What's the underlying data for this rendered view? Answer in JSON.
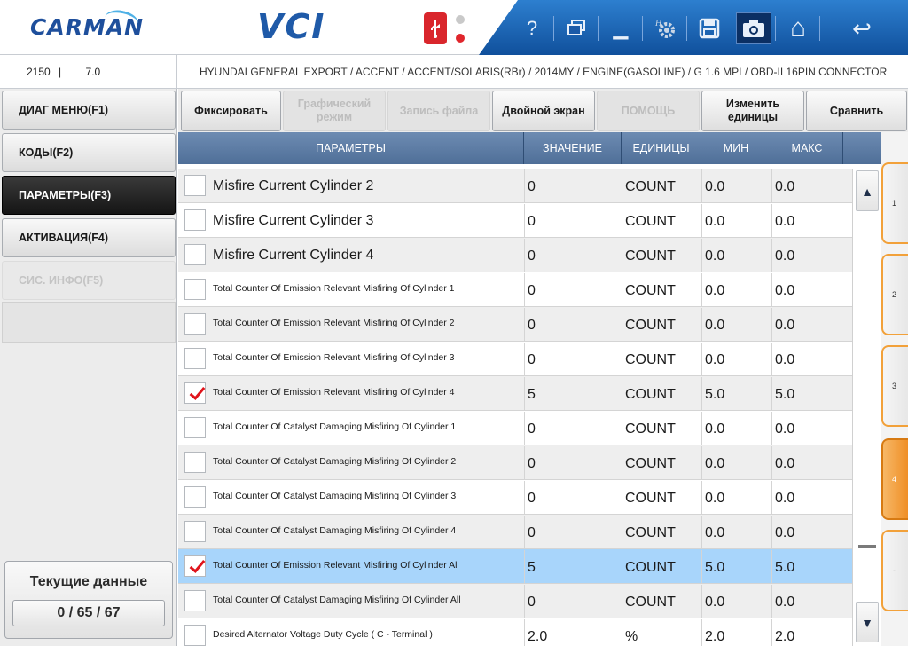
{
  "header": {
    "brand": "CARMAN",
    "product": "VCI",
    "toolbar_icons": [
      "help-icon",
      "window-icon",
      "minimize-icon",
      "settings-icon",
      "save-icon",
      "camera-icon",
      "home-icon",
      "back-icon"
    ],
    "toolbar_glyphs": {
      "help": "?",
      "minimize": "▁",
      "home": "⌂",
      "back": "↩"
    }
  },
  "info": {
    "code": "2150",
    "separator": "|",
    "version": "7.0",
    "path": "HYUNDAI GENERAL EXPORT / ACCENT / ACCENT/SOLARIS(RBr) / 2014MY / ENGINE(GASOLINE) / G 1.6 MPI / OBD-II 16PIN CONNECTOR"
  },
  "sidebar": {
    "items": [
      {
        "label": "ДИАГ МЕНЮ(F1)",
        "state": "normal"
      },
      {
        "label": "КОДЫ(F2)",
        "state": "normal"
      },
      {
        "label": "ПАРАМЕТРЫ(F3)",
        "state": "active"
      },
      {
        "label": "АКТИВАЦИЯ(F4)",
        "state": "normal"
      },
      {
        "label": "СИС. ИНФО(F5)",
        "state": "disabled"
      }
    ],
    "current_data_title": "Текущие данные",
    "counter": "0 / 65 / 67"
  },
  "actions": {
    "fix": "Фиксировать",
    "graph": "Графический режим",
    "record": "Запись файла",
    "dual": "Двойной экран",
    "help": "ПОМОЩЬ",
    "units": "Изменить единицы",
    "compare": "Сравнить"
  },
  "table": {
    "columns": {
      "params": "ПАРАМЕТРЫ",
      "value": "ЗНАЧЕНИЕ",
      "unit": "ЕДИНИЦЫ",
      "min": "МИН",
      "max": "МАКС"
    },
    "rows": [
      {
        "name": "Misfire Current Cylinder 2",
        "value": "0",
        "unit": "COUNT",
        "min": "0.0",
        "max": "0.0",
        "checked": false,
        "selected": false,
        "size": "big"
      },
      {
        "name": "Misfire Current Cylinder 3",
        "value": "0",
        "unit": "COUNT",
        "min": "0.0",
        "max": "0.0",
        "checked": false,
        "selected": false,
        "size": "big"
      },
      {
        "name": "Misfire Current Cylinder 4",
        "value": "0",
        "unit": "COUNT",
        "min": "0.0",
        "max": "0.0",
        "checked": false,
        "selected": false,
        "size": "big"
      },
      {
        "name": "Total Counter Of Emission Relevant Misfiring Of Cylinder 1",
        "value": "0",
        "unit": "COUNT",
        "min": "0.0",
        "max": "0.0",
        "checked": false,
        "selected": false,
        "size": "small"
      },
      {
        "name": "Total Counter Of Emission Relevant Misfiring Of Cylinder 2",
        "value": "0",
        "unit": "COUNT",
        "min": "0.0",
        "max": "0.0",
        "checked": false,
        "selected": false,
        "size": "small"
      },
      {
        "name": "Total Counter Of Emission Relevant Misfiring Of Cylinder 3",
        "value": "0",
        "unit": "COUNT",
        "min": "0.0",
        "max": "0.0",
        "checked": false,
        "selected": false,
        "size": "small"
      },
      {
        "name": "Total Counter Of Emission Relevant Misfiring Of Cylinder 4",
        "value": "5",
        "unit": "COUNT",
        "min": "5.0",
        "max": "5.0",
        "checked": true,
        "selected": false,
        "size": "small"
      },
      {
        "name": "Total Counter Of Catalyst Damaging Misfiring Of Cylinder 1",
        "value": "0",
        "unit": "COUNT",
        "min": "0.0",
        "max": "0.0",
        "checked": false,
        "selected": false,
        "size": "small"
      },
      {
        "name": "Total Counter Of Catalyst Damaging Misfiring Of Cylinder 2",
        "value": "0",
        "unit": "COUNT",
        "min": "0.0",
        "max": "0.0",
        "checked": false,
        "selected": false,
        "size": "small"
      },
      {
        "name": "Total Counter Of Catalyst Damaging Misfiring Of Cylinder 3",
        "value": "0",
        "unit": "COUNT",
        "min": "0.0",
        "max": "0.0",
        "checked": false,
        "selected": false,
        "size": "small"
      },
      {
        "name": "Total Counter Of Catalyst Damaging Misfiring Of Cylinder 4",
        "value": "0",
        "unit": "COUNT",
        "min": "0.0",
        "max": "0.0",
        "checked": false,
        "selected": false,
        "size": "small"
      },
      {
        "name": "Total Counter Of Emission Relevant Misfiring Of Cylinder All",
        "value": "5",
        "unit": "COUNT",
        "min": "5.0",
        "max": "5.0",
        "checked": true,
        "selected": true,
        "size": "small"
      },
      {
        "name": "Total Counter Of Catalyst Damaging Misfiring Of Cylinder All",
        "value": "0",
        "unit": "COUNT",
        "min": "0.0",
        "max": "0.0",
        "checked": false,
        "selected": false,
        "size": "small"
      },
      {
        "name": "Desired Alternator Voltage Duty Cycle ( C - Terminal )",
        "value": "2.0",
        "unit": "%",
        "min": "2.0",
        "max": "2.0",
        "checked": false,
        "selected": false,
        "size": "small"
      }
    ]
  },
  "scrollbar": {
    "up": "▲",
    "down": "▼"
  },
  "right_tabs": {
    "items": [
      {
        "label": "1",
        "active": false
      },
      {
        "label": "2",
        "active": false
      },
      {
        "label": "3",
        "active": false
      },
      {
        "label": "4",
        "active": true
      },
      {
        "label": "-",
        "active": false
      }
    ]
  },
  "colors": {
    "toolbar_blue": "#1f66b5",
    "header_table": "#5e7ca4",
    "selected_row": "#a8d5fb",
    "check_red": "#e0141b",
    "tab_orange": "#f2a13a",
    "sidebar_active": "#1e1e1e"
  }
}
